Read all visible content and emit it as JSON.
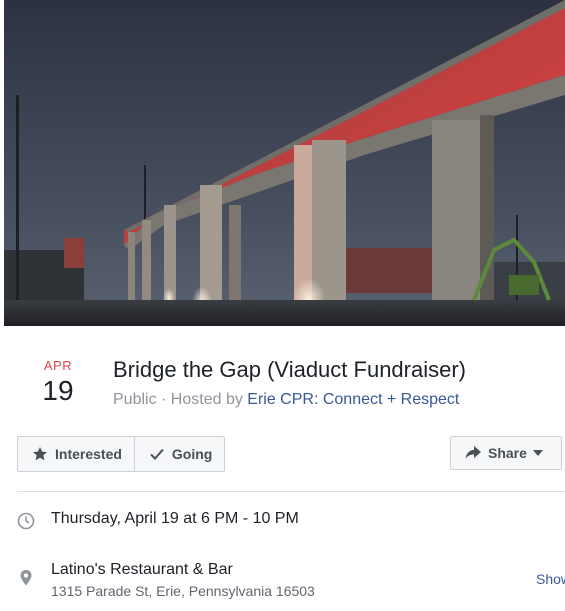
{
  "event": {
    "month": "APR",
    "day": "19",
    "title": "Bridge the Gap (Viaduct Fundraiser)",
    "privacy": "Public",
    "hosted_by_prefix": " · Hosted by ",
    "host": "Erie CPR: Connect + Respect"
  },
  "actions": {
    "interested_label": "Interested",
    "going_label": "Going",
    "share_label": "Share"
  },
  "details": {
    "datetime": "Thursday, April 19 at 6 PM - 10 PM",
    "place_name": "Latino's Restaurant & Bar",
    "place_address": "1315 Parade St, Erie, Pennsylvania 16503",
    "show_map_label": "Show"
  },
  "icons": {
    "interested": "star-icon",
    "going": "check-icon",
    "share": "share-arrow-icon",
    "share_menu": "caret-down-icon",
    "time": "clock-icon",
    "place": "location-pin-icon"
  },
  "colors": {
    "month_red": "#e0434f",
    "link_blue": "#385898",
    "text_dark": "#1d2129",
    "text_gray": "#90949c"
  }
}
